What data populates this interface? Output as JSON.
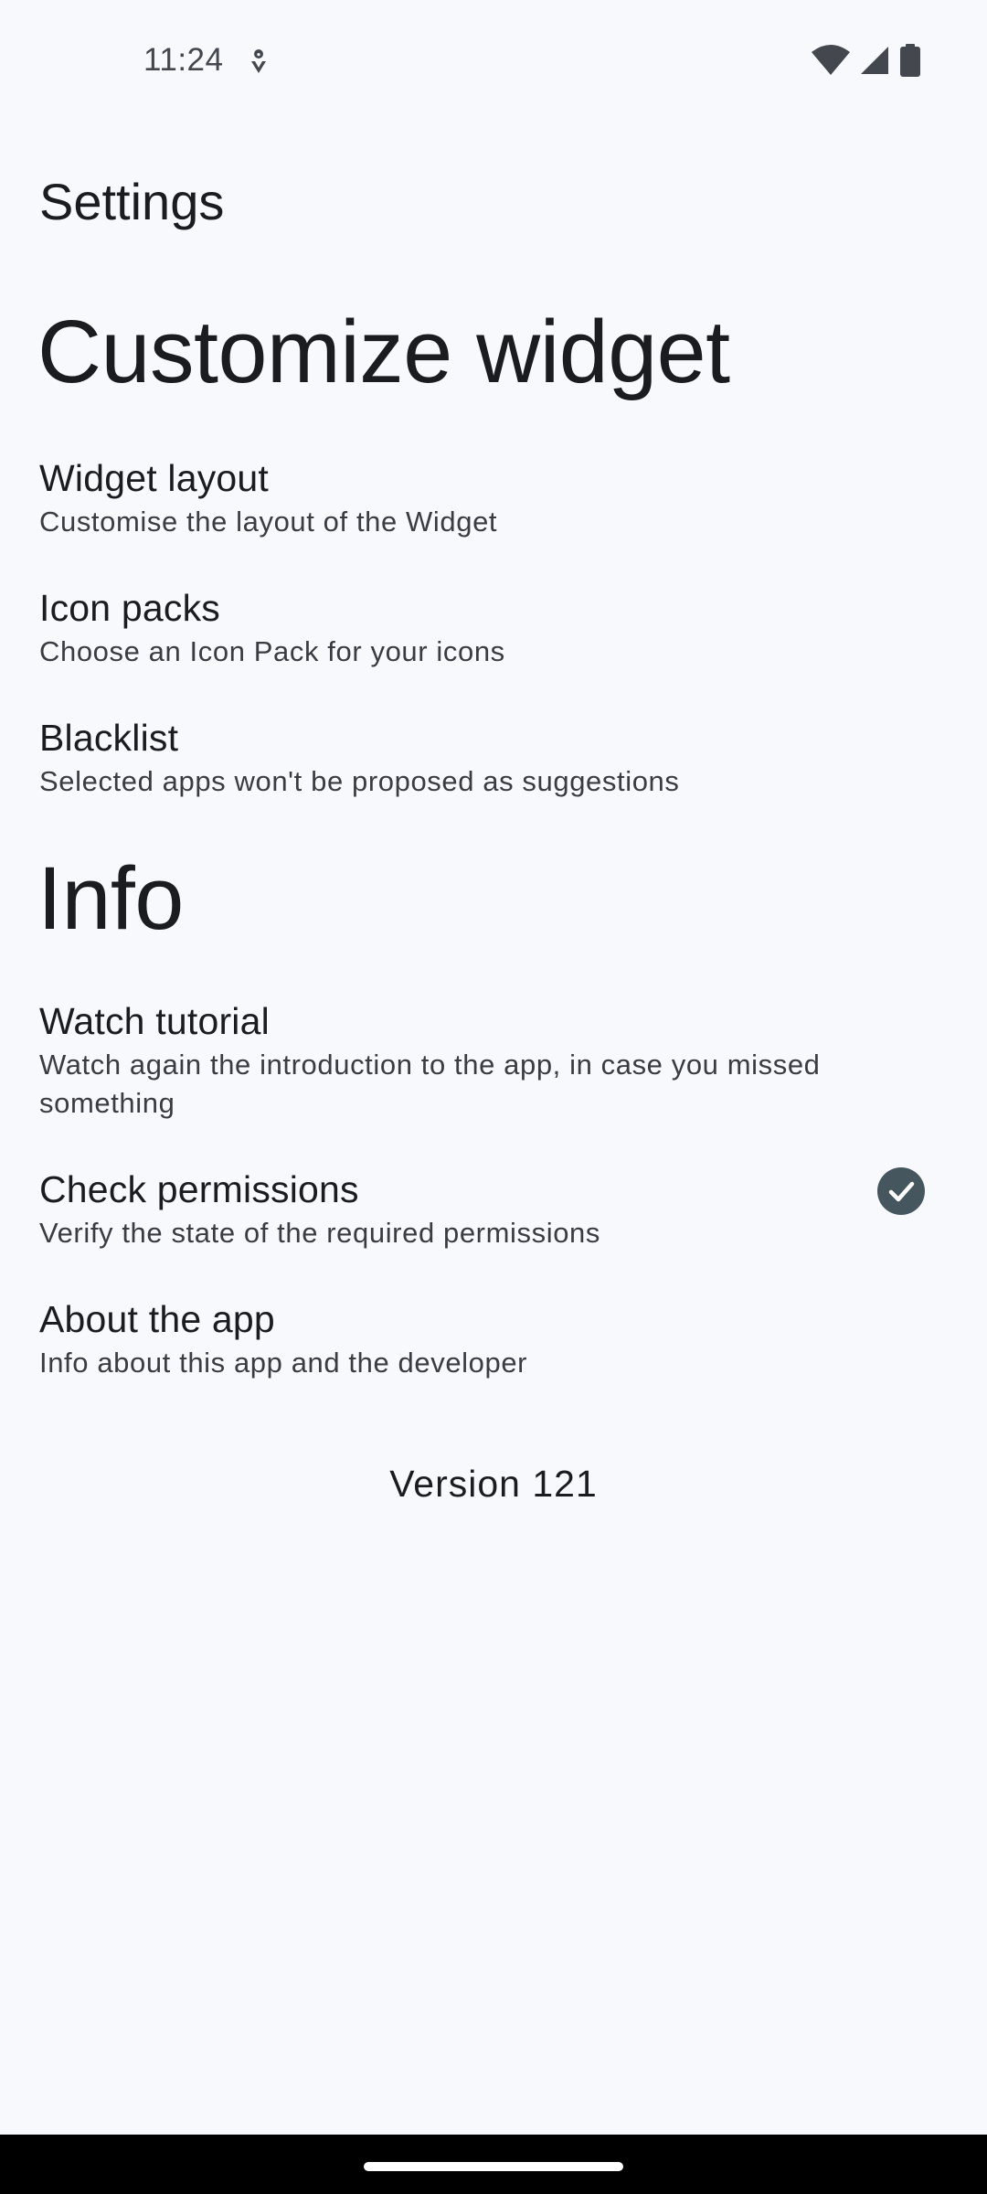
{
  "status_bar": {
    "time": "11:24"
  },
  "header": {
    "title": "Settings"
  },
  "sections": {
    "customize": {
      "title": "Customize widget",
      "items": [
        {
          "title": "Widget layout",
          "summary": "Customise the layout of the Widget"
        },
        {
          "title": "Icon packs",
          "summary": "Choose an Icon Pack for your icons"
        },
        {
          "title": "Blacklist",
          "summary": "Selected apps won't be proposed as suggestions"
        }
      ]
    },
    "info": {
      "title": "Info",
      "items": [
        {
          "title": "Watch tutorial",
          "summary": "Watch again the introduction to the app, in case you missed something"
        },
        {
          "title": "Check permissions",
          "summary": "Verify the state of the required permissions",
          "status_icon": "check-circle-icon"
        },
        {
          "title": "About the app",
          "summary": "Info about this app and the developer"
        }
      ]
    }
  },
  "footer": {
    "version": "Version 121"
  },
  "colors": {
    "background": "#f8f9fd",
    "text": "#1b1c20",
    "badge": "#45565f"
  }
}
